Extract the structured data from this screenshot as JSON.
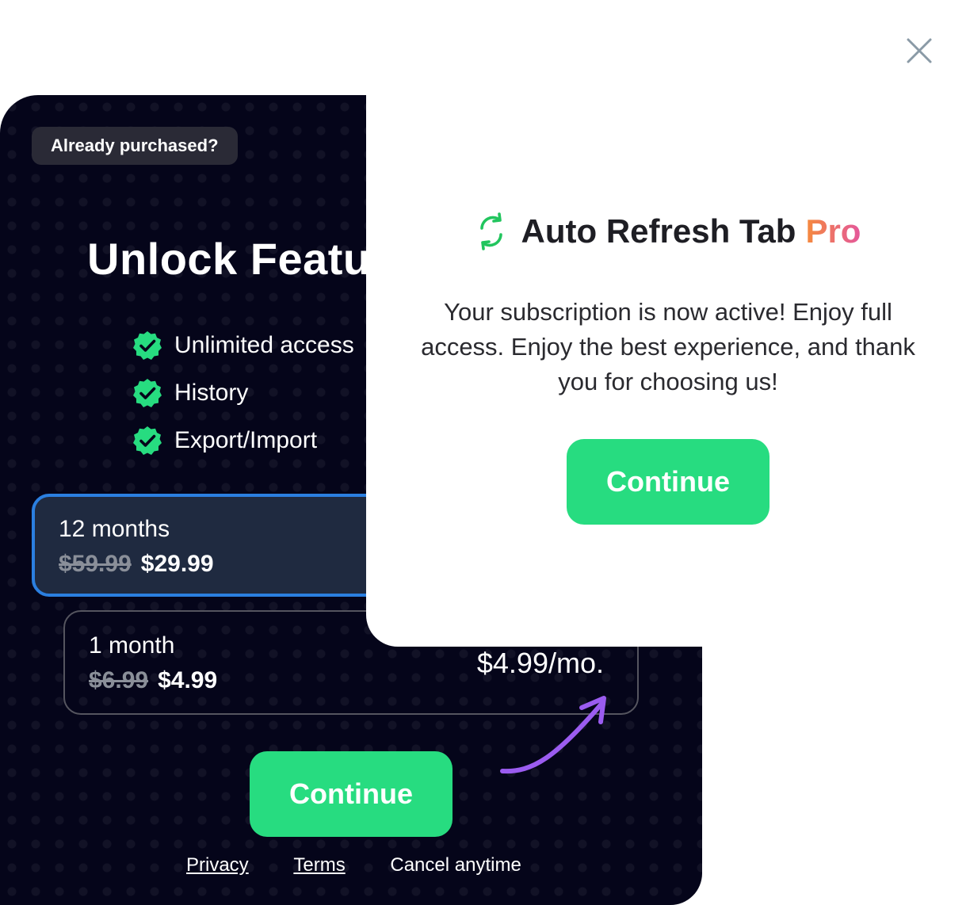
{
  "close": {
    "icon": "close-icon"
  },
  "paywall": {
    "already_purchased_label": "Already purchased?",
    "title": "Unlock Featu",
    "features": [
      {
        "label": "Unlimited access",
        "icon": "check-badge-icon"
      },
      {
        "label": "History",
        "icon": "check-badge-icon"
      },
      {
        "label": "Export/Import",
        "icon": "check-badge-icon"
      }
    ],
    "plans": [
      {
        "name": "12 months",
        "old_price": "$59.99",
        "price": "$29.99",
        "selected": true
      },
      {
        "name": "1 month",
        "old_price": "$6.99",
        "price": "$4.99",
        "per_month": "$4.99/mo.",
        "selected": false
      }
    ],
    "continue_label": "Continue",
    "footer": {
      "privacy": "Privacy",
      "terms": "Terms",
      "cancel": "Cancel anytime"
    }
  },
  "success": {
    "brand_name": "Auto Refresh Tab",
    "brand_pro": "Pro",
    "brand_icon": "refresh-icon",
    "message": "Your subscription is now active! Enjoy full access. Enjoy the best experience, and thank you for choosing us!",
    "continue_label": "Continue"
  },
  "colors": {
    "panel_bg": "#05051a",
    "accent_green": "#27dc80",
    "selected_border": "#2b7fe0",
    "check_green": "#27dc80",
    "arrow_purple": "#9b5cf0",
    "pro_gradient": [
      "#f58b3c",
      "#e4579b"
    ]
  }
}
